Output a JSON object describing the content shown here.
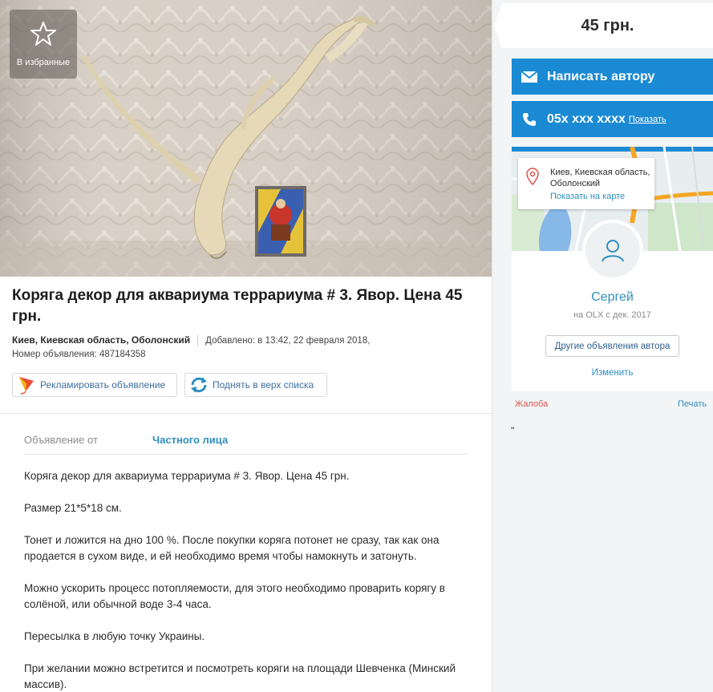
{
  "photo": {
    "favorite_label": "В избранные"
  },
  "ad": {
    "title": "Коряга декор для аквариума террариума # 3. Явор. Цена 45 грн.",
    "location": "Киев, Киевская область, Оболонский",
    "added": "Добавлено: в 13:42, 22 февраля 2018,",
    "number": "Номер объявления: 487184358"
  },
  "actions": {
    "promote_label": "Рекламировать объявление",
    "raise_label": "Поднять в верх списка"
  },
  "params": {
    "key": "Объявление от",
    "value": "Частного лица"
  },
  "description": [
    "Коряга декор для аквариума террариума # 3. Явор. Цена 45 грн.",
    "Размер 21*5*18 см.",
    "Тонет и ложится на дно 100 %. После покупки коряга потонет не сразу, так как она продается в сухом виде, и ей необходимо время чтобы намокнуть и затонуть.",
    "Можно ускорить процесс потопляемости, для этого необходимо проварить корягу в солёной, или обычной воде 3-4 часа.",
    "Пересылка в любую точку Украины.",
    "При желании можно встретится и посмотреть коряги на площади Шевченка (Минский массив)."
  ],
  "sidebar": {
    "price": "45 грн.",
    "message_label": "Написать автору",
    "phone": "05х ххх хххх",
    "phone_show": "Показать",
    "location_line1": "Киев, Киевская область,",
    "location_line2": "Оболонский",
    "show_on_map": "Показать на карте",
    "seller_name": "Сергей",
    "seller_since": "на OLX с дек. 2017",
    "other_ads": "Другие объявления автора",
    "change": "Изменить",
    "complaint": "Жалоба",
    "print": "Печать",
    "stray_mark": "\""
  },
  "colors": {
    "accent": "#1a8ad4",
    "link": "#2f8fbf",
    "complaint": "#d9534f"
  }
}
